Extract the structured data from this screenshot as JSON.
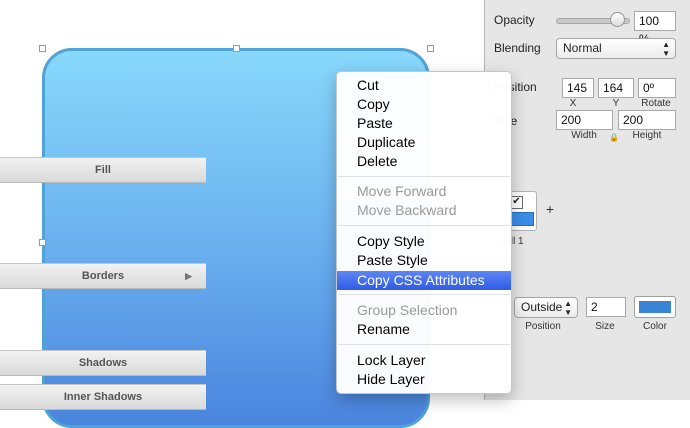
{
  "inspector": {
    "opacity": {
      "label": "Opacity",
      "value": "100 %",
      "level": 1.0
    },
    "blending": {
      "label": "Blending",
      "value": "Normal"
    },
    "position": {
      "label": "Position",
      "x": "145",
      "y": "164",
      "rotate": "0º",
      "x_label": "X",
      "y_label": "Y",
      "rotate_label": "Rotate"
    },
    "size": {
      "label": "Size",
      "width": "200",
      "height": "200",
      "width_label": "Width",
      "height_label": "Height"
    },
    "fill": {
      "header": "Fill",
      "item_label": "Fill 1",
      "add": "+",
      "color": "#3b8ee8"
    },
    "borders": {
      "header": "Borders",
      "position": "Outside",
      "size": "2",
      "position_label": "Position",
      "size_label": "Size",
      "color_label": "Color",
      "color": "#3a84d6"
    },
    "shadows": {
      "header": "Shadows"
    },
    "inner_shadows": {
      "header": "Inner Shadows"
    }
  },
  "context_menu": {
    "groups": [
      [
        {
          "label": "Cut",
          "enabled": true
        },
        {
          "label": "Copy",
          "enabled": true
        },
        {
          "label": "Paste",
          "enabled": true
        },
        {
          "label": "Duplicate",
          "enabled": true
        },
        {
          "label": "Delete",
          "enabled": true
        }
      ],
      [
        {
          "label": "Move Forward",
          "enabled": false
        },
        {
          "label": "Move Backward",
          "enabled": false
        }
      ],
      [
        {
          "label": "Copy Style",
          "enabled": true
        },
        {
          "label": "Paste Style",
          "enabled": true
        },
        {
          "label": "Copy CSS Attributes",
          "enabled": true,
          "highlighted": true
        }
      ],
      [
        {
          "label": "Group Selection",
          "enabled": false
        },
        {
          "label": "Rename",
          "enabled": true
        }
      ],
      [
        {
          "label": "Lock Layer",
          "enabled": true
        },
        {
          "label": "Hide Layer",
          "enabled": true
        }
      ]
    ]
  },
  "colors": {
    "shape_top": "#88d8fb",
    "shape_bottom": "#4a84de",
    "menu_highlight": "#3a66ea"
  }
}
